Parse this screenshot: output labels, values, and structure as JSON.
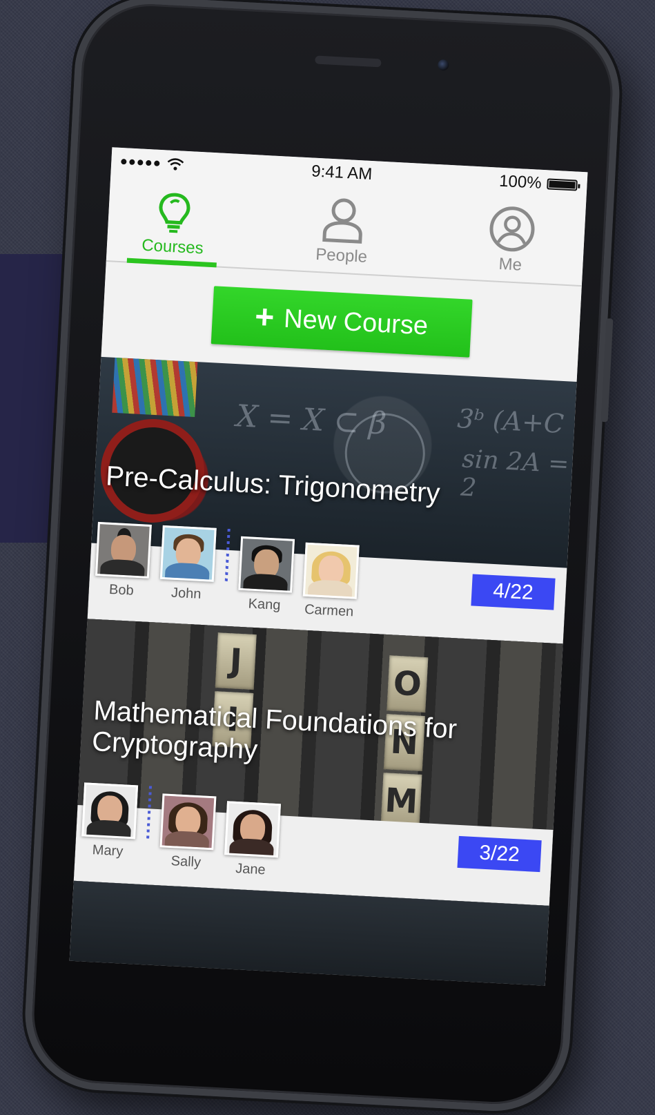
{
  "status_bar": {
    "time": "9:41 AM",
    "battery": "100%",
    "battery_level": 1.0
  },
  "tabs": [
    {
      "label": "Courses",
      "icon": "lightbulb-icon",
      "active": true
    },
    {
      "label": "People",
      "icon": "person-icon",
      "active": false
    },
    {
      "label": "Me",
      "icon": "profile-circle-icon",
      "active": false
    }
  ],
  "new_course_button": {
    "plus": "+",
    "label": "New Course"
  },
  "courses": [
    {
      "title": "Pre-Calculus: Trigonometry",
      "progress": "4/22",
      "members": [
        "Bob",
        "John",
        "Kang",
        "Carmen"
      ]
    },
    {
      "title": "Mathematical Foundations for Cryptography",
      "progress": "3/22",
      "members": [
        "Mary",
        "Sally",
        "Jane"
      ]
    }
  ],
  "colors": {
    "accent_green": "#25b91e",
    "badge_blue": "#3b48f3",
    "background": "#353848",
    "panel": "#262548"
  }
}
